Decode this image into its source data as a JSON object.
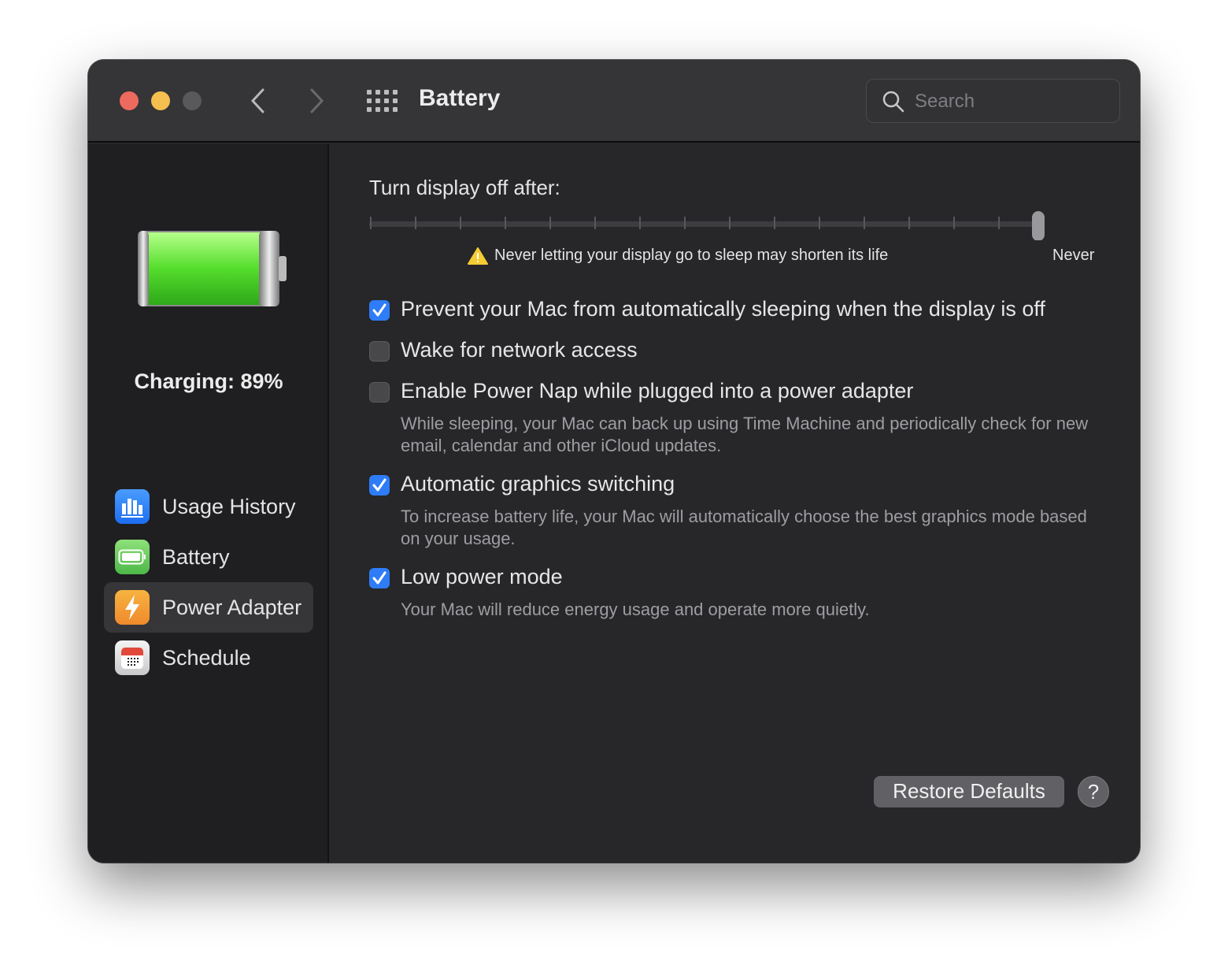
{
  "window": {
    "title": "Battery",
    "search_placeholder": "Search"
  },
  "sidebar": {
    "status": "Charging: 89%",
    "battery_level_percent": 89,
    "items": [
      {
        "label": "Usage History",
        "icon": "bar-chart-icon"
      },
      {
        "label": "Battery",
        "icon": "battery-icon"
      },
      {
        "label": "Power Adapter",
        "icon": "bolt-icon",
        "selected": true
      },
      {
        "label": "Schedule",
        "icon": "calendar-icon"
      }
    ]
  },
  "main": {
    "slider_label": "Turn display off after:",
    "slider_value": "Never",
    "slider_position": "max",
    "slider_end_label": "Never",
    "warning": "Never letting your display go to sleep may shorten its life",
    "options": [
      {
        "label": "Prevent your Mac from automatically sleeping when the display is off",
        "checked": true
      },
      {
        "label": "Wake for network access",
        "checked": false
      },
      {
        "label": "Enable Power Nap while plugged into a power adapter",
        "checked": false,
        "description": "While sleeping, your Mac can back up using Time Machine and periodically check for new email, calendar and other iCloud updates."
      },
      {
        "label": "Automatic graphics switching",
        "checked": true,
        "description": "To increase battery life, your Mac will automatically choose the best graphics mode based on your usage."
      },
      {
        "label": "Low power mode",
        "checked": true,
        "description": "Your Mac will reduce energy usage and operate more quietly."
      }
    ],
    "restore_label": "Restore Defaults",
    "help_label": "?"
  },
  "colors": {
    "accent": "#2e7cf6",
    "close": "#ed6a5e",
    "minimize": "#f5bf4f",
    "battery": "#5ee03a"
  }
}
